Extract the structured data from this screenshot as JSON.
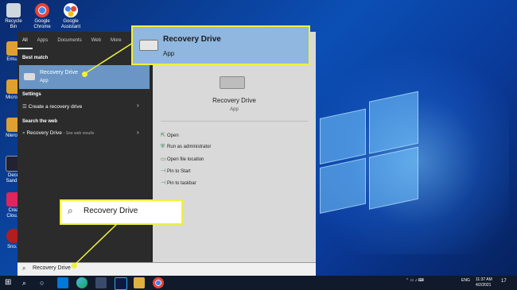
{
  "desktop": {
    "icons": [
      {
        "label": "Recycle Bin"
      },
      {
        "label": "Google Chrome"
      },
      {
        "label": "Google Assistant"
      },
      {
        "label": "Emu..."
      },
      {
        "label": "Micro..."
      },
      {
        "label": "Ntero..."
      },
      {
        "label": "Dece Sand..."
      },
      {
        "label": "Crea Clou..."
      },
      {
        "label": "Sno..."
      }
    ]
  },
  "start_menu": {
    "tabs": [
      "All",
      "Apps",
      "Documents",
      "Web",
      "More"
    ],
    "sections": {
      "best_match": "Best match",
      "settings": "Settings",
      "search_web": "Search the web"
    },
    "best_match_item": {
      "title": "Recovery Drive",
      "subtitle": "App"
    },
    "settings_item": "Create a recovery drive",
    "web_item": {
      "title": "Recovery Drive",
      "suffix": "- See web results"
    },
    "right_panel": {
      "title": "Recovery Drive",
      "subtitle": "App",
      "actions": [
        "Open",
        "Run as administrator",
        "Open file location",
        "Pin to Start",
        "Pin to taskbar"
      ]
    }
  },
  "search": {
    "query": "Recovery Drive"
  },
  "callouts": {
    "app_title": "Recovery Drive",
    "app_sub": "App",
    "search_text": "Recovery Drive"
  },
  "taskbar": {
    "lang": "ENG",
    "time": "11:37 AM",
    "date": "4/2/2021",
    "notification_count": "17"
  },
  "colors": {
    "highlight": "#f1f03a",
    "selected": "#6a95c4"
  }
}
